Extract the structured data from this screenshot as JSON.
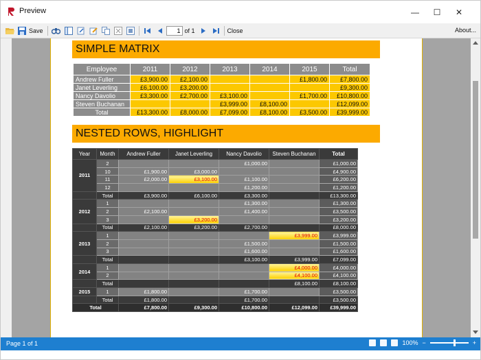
{
  "window": {
    "title": "Preview",
    "controls": [
      "—",
      "☐",
      "✕"
    ]
  },
  "toolbar": {
    "save_label": "Save",
    "page_value": "1",
    "of_label": "of 1",
    "close_label": "Close",
    "about_label": "About..."
  },
  "status": {
    "page_label": "Page 1 of 1",
    "zoom_label": "100%",
    "zoom_minus": "−",
    "zoom_plus": "+"
  },
  "simple_matrix": {
    "title": "SIMPLE MATRIX",
    "corner": "Employee",
    "columns": [
      "2011",
      "2012",
      "2013",
      "2014",
      "2015",
      "Total"
    ],
    "rows": [
      {
        "name": "Andrew Fuller",
        "values": [
          "£3,900.00",
          "£2,100.00",
          "",
          "",
          "£1,800.00",
          "£7,800.00"
        ]
      },
      {
        "name": "Janet Leverling",
        "values": [
          "£6,100.00",
          "£3,200.00",
          "",
          "",
          "",
          "£9,300.00"
        ]
      },
      {
        "name": "Nancy Davolio",
        "values": [
          "£3,300.00",
          "£2,700.00",
          "£3,100.00",
          "",
          "£1,700.00",
          "£10,800.00"
        ]
      },
      {
        "name": "Steven Buchanan",
        "values": [
          "",
          "",
          "£3,999.00",
          "£8,100.00",
          "",
          "£12,099.00"
        ]
      },
      {
        "name": "Total",
        "values": [
          "£13,300.00",
          "£8,000.00",
          "£7,099.00",
          "£8,100.00",
          "£3,500.00",
          "£39,999.00"
        ]
      }
    ]
  },
  "nested": {
    "title": "NESTED ROWS, HIGHLIGHT",
    "headers": [
      "Year",
      "Month",
      "Andrew Fuller",
      "Janet Leverling",
      "Nancy Davolio",
      "Steven Buchanan",
      "Total"
    ],
    "years": [
      {
        "year": "2011",
        "rows": [
          {
            "m": "2",
            "v": [
              "",
              "",
              "£1,000.00",
              ""
            ],
            "t": "£1,000.00"
          },
          {
            "m": "10",
            "v": [
              "£1,900.00",
              "£3,000.00",
              "",
              ""
            ],
            "t": "£4,900.00"
          },
          {
            "m": "11",
            "v": [
              "£2,000.00",
              "£3,100.00",
              "£1,100.00",
              ""
            ],
            "t": "£6,200.00",
            "hl": [
              1
            ]
          },
          {
            "m": "12",
            "v": [
              "",
              "",
              "£1,200.00",
              ""
            ],
            "t": "£1,200.00"
          },
          {
            "m": "Total",
            "v": [
              "£3,900.00",
              "£6,100.00",
              "£3,300.00",
              ""
            ],
            "t": "£13,300.00",
            "total": true
          }
        ]
      },
      {
        "year": "2012",
        "rows": [
          {
            "m": "1",
            "v": [
              "",
              "",
              "£1,300.00",
              ""
            ],
            "t": "£1,300.00"
          },
          {
            "m": "2",
            "v": [
              "£2,100.00",
              "",
              "£1,400.00",
              ""
            ],
            "t": "£3,500.00"
          },
          {
            "m": "3",
            "v": [
              "",
              "£3,200.00",
              "",
              ""
            ],
            "t": "£3,200.00",
            "hl": [
              1
            ]
          },
          {
            "m": "Total",
            "v": [
              "£2,100.00",
              "£3,200.00",
              "£2,700.00",
              ""
            ],
            "t": "£8,000.00",
            "total": true
          }
        ]
      },
      {
        "year": "2013",
        "rows": [
          {
            "m": "1",
            "v": [
              "",
              "",
              "",
              "£3,999.00"
            ],
            "t": "£3,999.00",
            "hl": [
              3
            ]
          },
          {
            "m": "2",
            "v": [
              "",
              "",
              "£1,500.00",
              ""
            ],
            "t": "£1,500.00"
          },
          {
            "m": "3",
            "v": [
              "",
              "",
              "£1,600.00",
              ""
            ],
            "t": "£1,600.00"
          },
          {
            "m": "Total",
            "v": [
              "",
              "",
              "£3,100.00",
              "£3,999.00"
            ],
            "t": "£7,099.00",
            "total": true
          }
        ]
      },
      {
        "year": "2014",
        "rows": [
          {
            "m": "1",
            "v": [
              "",
              "",
              "",
              "£4,000.00"
            ],
            "t": "£4,000.00",
            "hl": [
              3
            ]
          },
          {
            "m": "2",
            "v": [
              "",
              "",
              "",
              "£4,100.00"
            ],
            "t": "£4,100.00",
            "hl": [
              3
            ]
          },
          {
            "m": "Total",
            "v": [
              "",
              "",
              "",
              "£8,100.00"
            ],
            "t": "£8,100.00",
            "total": true
          }
        ]
      },
      {
        "year": "2015",
        "rows": [
          {
            "m": "1",
            "v": [
              "£1,800.00",
              "",
              "£1,700.00",
              ""
            ],
            "t": "£3,500.00"
          },
          {
            "m": "Total",
            "v": [
              "£1,800.00",
              "",
              "£1,700.00",
              ""
            ],
            "t": "£3,500.00",
            "total": true
          }
        ]
      }
    ],
    "grand_total": {
      "label": "Total",
      "v": [
        "£7,800.00",
        "£9,300.00",
        "£10,800.00",
        "£12,099.00"
      ],
      "t": "£39,999.00"
    }
  }
}
